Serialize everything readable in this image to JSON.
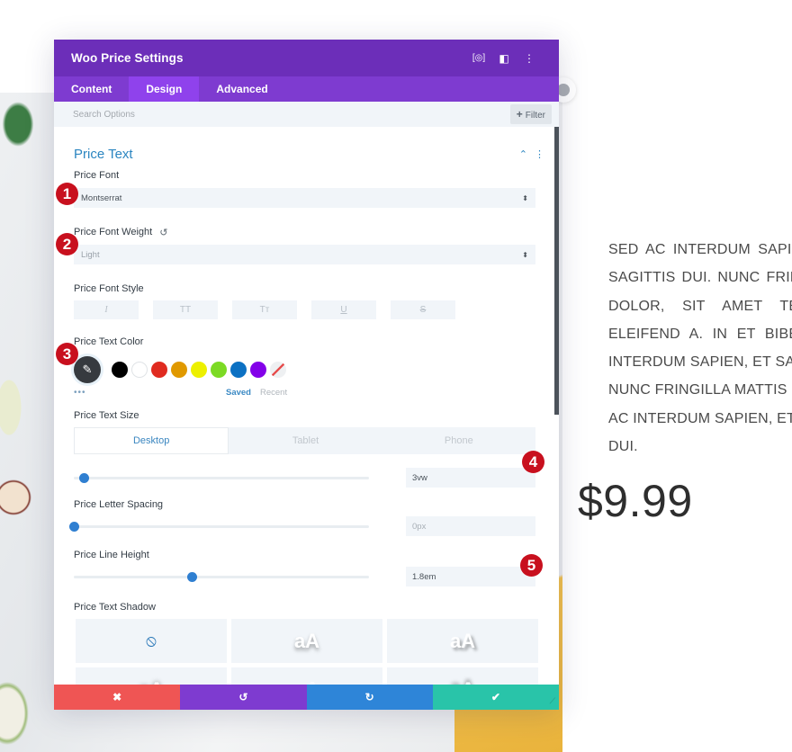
{
  "page": {
    "body_text_lines": [
      "SED AC INTERDUM SAPIEN, ET",
      "SAGITTIS DUI. NUNC FRINGILLA",
      "DOLOR, SIT AMET TEMPOR",
      "ELEIFEND A. IN ET BIBENDUM",
      "INTERDUM SAPIEN, ET SAGITTIS",
      "NUNC FRINGILLA MATTIS DOLOR",
      "AC INTERDUM SAPIEN, ET SAGITTIS",
      "DUI."
    ],
    "price": "$9.99"
  },
  "modal": {
    "title": "Woo Price Settings",
    "header_icons": [
      "fullscreen-icon",
      "split-view-icon",
      "more-options-icon"
    ],
    "tabs": [
      {
        "label": "Content",
        "active": false
      },
      {
        "label": "Design",
        "active": true
      },
      {
        "label": "Advanced",
        "active": false
      }
    ],
    "search": {
      "placeholder": "Search Options",
      "value": ""
    },
    "filter_label": "Filter",
    "section": {
      "title": "Price Text",
      "fields": {
        "font": {
          "label": "Price Font",
          "value": "Montserrat"
        },
        "font_weight": {
          "label": "Price Font Weight",
          "value": "Light"
        },
        "font_style": {
          "label": "Price Font Style",
          "options": [
            "I",
            "TT",
            "Tт",
            "U",
            "S"
          ]
        },
        "text_color": {
          "label": "Price Text Color",
          "swatches": [
            "#000000",
            "#ffffff",
            "#e02b20",
            "#e09900",
            "#edf000",
            "#7cda24",
            "#0c71c3",
            "#8300e9"
          ],
          "saved_label": "Saved",
          "recent_label": "Recent",
          "more_label": "•••"
        },
        "text_size": {
          "label": "Price Text Size",
          "devices": [
            {
              "label": "Desktop",
              "active": true
            },
            {
              "label": "Tablet",
              "active": false
            },
            {
              "label": "Phone",
              "active": false
            }
          ],
          "value": "3vw",
          "slider_fraction": 0.035
        },
        "letter_spacing": {
          "label": "Price Letter Spacing",
          "value": "0px",
          "slider_fraction": 0.0
        },
        "line_height": {
          "label": "Price Line Height",
          "value": "1.8em",
          "slider_fraction": 0.4
        },
        "text_shadow": {
          "label": "Price Text Shadow",
          "options": [
            "none",
            "aA",
            "aA",
            "aA",
            "aA",
            "aA"
          ]
        }
      }
    },
    "footer": {
      "cancel_icon": "✖",
      "undo_icon": "↺",
      "redo_icon": "↻",
      "save_icon": "✔"
    }
  },
  "callouts": [
    "1",
    "2",
    "3",
    "4",
    "5"
  ],
  "colors": {
    "header": "#6c2eb9",
    "tabs": "#7e3bd0",
    "accent_blue": "#2c86c1",
    "cancel": "#ef5554",
    "undo": "#7e3bd0",
    "redo": "#2e85d8",
    "save": "#29c4a9",
    "callout": "#c8101e"
  }
}
